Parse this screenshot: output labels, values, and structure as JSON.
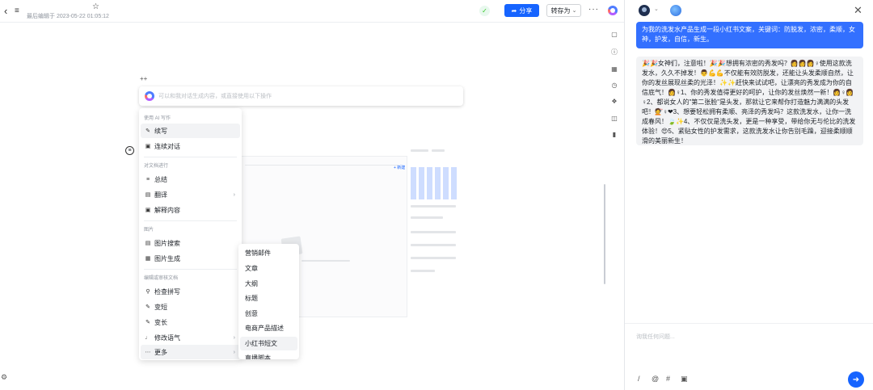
{
  "topbar": {
    "edit_info": "最后编辑于 2023-05-22 01:05:12",
    "share_label": "分享",
    "save_as_label": "转存为",
    "more_label": "···"
  },
  "ai_input": {
    "placeholder": "可以和我对话生成内容，或直接使用以下操作"
  },
  "drag_handle": "++",
  "menu": {
    "group_ai_write": "使用 AI 写作",
    "item_write": "续写",
    "item_continue_chat": "连续对话",
    "group_doc": "对文档进行",
    "item_summary": "总结",
    "item_translate": "翻译",
    "item_explain": "解释内容",
    "group_image": "图片",
    "item_image_search": "图片搜索",
    "item_image_gen": "图片生成",
    "group_edit": "编辑或审核文档",
    "item_spellcheck": "检查拼写",
    "item_shorter": "变短",
    "item_longer": "变长",
    "item_tone": "修改语气",
    "item_more": "更多"
  },
  "submenu": {
    "items": [
      "营销邮件",
      "文章",
      "大纲",
      "标题",
      "创意",
      "电商产品描述",
      "小红书短文",
      "直播脚本"
    ]
  },
  "chat": {
    "user_message": "为我的洗发水产品生成一段小红书文案，关键词：防脱发，浓密，柔顺，女神，护发，自信，新生。",
    "ai_reply": "🎉🎉女神们，注意啦！🎉🎉想拥有浓密的秀发吗？👩👩👩♀使用这款洗发水，久久不掉发！👨💪💪不仅能有效防脱发，还能让头发柔顺自然，让你的发丝展现丝柔的光泽！✨✨赶快来试试吧，让漂亮的秀发成为你的自信底气！👩♀1、你的秀发值得更好的呵护，让你的发丝焕然一新！👩♀👩♀2、都说女人的\"第二张脸\"是头发，那就让它来帮你打造魅力满满的头发吧！💇♀❤3、想要轻松拥有柔顺、亮泽的秀发吗？这款洗发水，让你一洗成春风！🍃✨4、不仅仅是洗头发，更是一种享受，带给你无与伦比的洗发体验！😍5、紧贴女性的护发需求，这款洗发水让你告别毛躁，迎接柔顺顺滑的美丽新生！",
    "input_placeholder": "询我任何问题..."
  },
  "colors": {
    "accent": "#1664ff",
    "user_bubble": "#3370ff",
    "ai_bubble": "#f2f3f5"
  },
  "icons": [
    "back-icon",
    "outline-icon",
    "star-icon",
    "share-icon",
    "chevron-down-icon",
    "close-icon",
    "send-icon",
    "settings-icon"
  ]
}
